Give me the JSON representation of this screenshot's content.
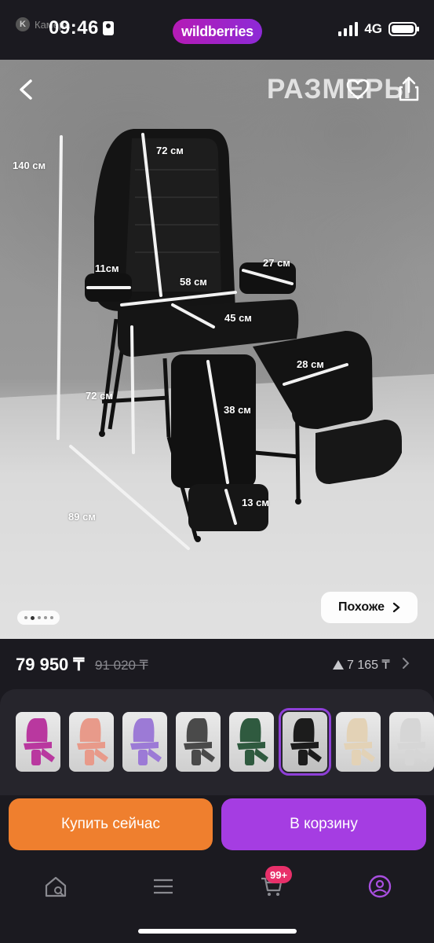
{
  "status_bar": {
    "back_app": "Камера",
    "time": "09:46",
    "brand": "wildberries",
    "network": "4G"
  },
  "gallery": {
    "watermark": "РАЗМЕРЫ",
    "dimensions": {
      "height_total": "140 см",
      "back": "72 см",
      "arm_width": "11см",
      "arm_length": "27 см",
      "seat_width": "58 см",
      "seat_depth": "45 см",
      "leg_rest_width": "28 см",
      "seat_height": "72 см",
      "leg_rest_length": "38 см",
      "foot_rest": "13 см",
      "depth_total": "89 см"
    },
    "similar_label": "Похоже",
    "dots_count": 5,
    "active_dot": 1
  },
  "product": {
    "price": "79 950 ₸",
    "old_price": "91 020 ₸",
    "rating_change": "7 165 ₸"
  },
  "variants": [
    {
      "color": "#b9389f"
    },
    {
      "color": "#e89a8a"
    },
    {
      "color": "#9c7ad6"
    },
    {
      "color": "#4a4a4a"
    },
    {
      "color": "#2f5a3f"
    },
    {
      "color": "#1c1c1c"
    },
    {
      "color": "#e3d2b6"
    },
    {
      "color": "#d6d6d6"
    }
  ],
  "actions": {
    "buy_now": "Купить сейчас",
    "add_to_cart": "В корзину"
  },
  "tabbar": {
    "cart_badge": "99+"
  },
  "colors": {
    "buy_button": "#ef7f2e",
    "cart_button": "#a53de2",
    "badge": "#e8306a"
  }
}
